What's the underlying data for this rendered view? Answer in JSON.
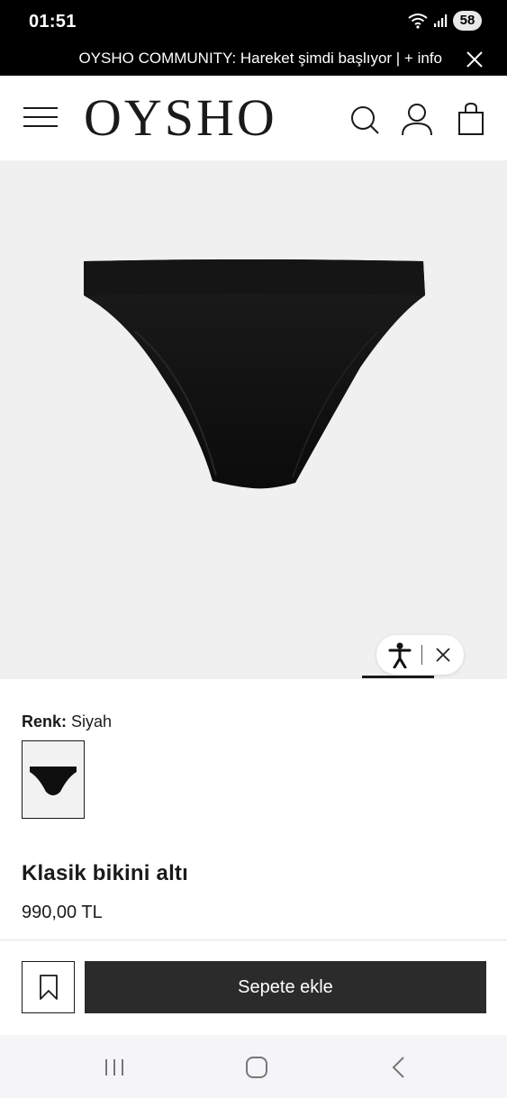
{
  "status_bar": {
    "time": "01:51",
    "battery": "58",
    "icons": [
      "wifi-icon",
      "signal-icon",
      "battery-icon"
    ]
  },
  "promo": {
    "text": "OYSHO COMMUNITY: Hareket şimdi başlıyor | + info"
  },
  "header": {
    "logo": "OYSHO",
    "icons": [
      "menu-icon",
      "search-icon",
      "account-icon",
      "bag-icon"
    ]
  },
  "product": {
    "color_label": "Renk:",
    "color_value": "Siyah",
    "title": "Klasik bikini altı",
    "price": "990,00 TL"
  },
  "actions": {
    "add_to_cart": "Sepete ekle"
  },
  "colors": {
    "promo_bg": "#000000",
    "image_bg": "#f0f0f0",
    "product": "#111111",
    "button_bg": "#2b2b2b",
    "nav_bg": "#f5f5f8"
  }
}
